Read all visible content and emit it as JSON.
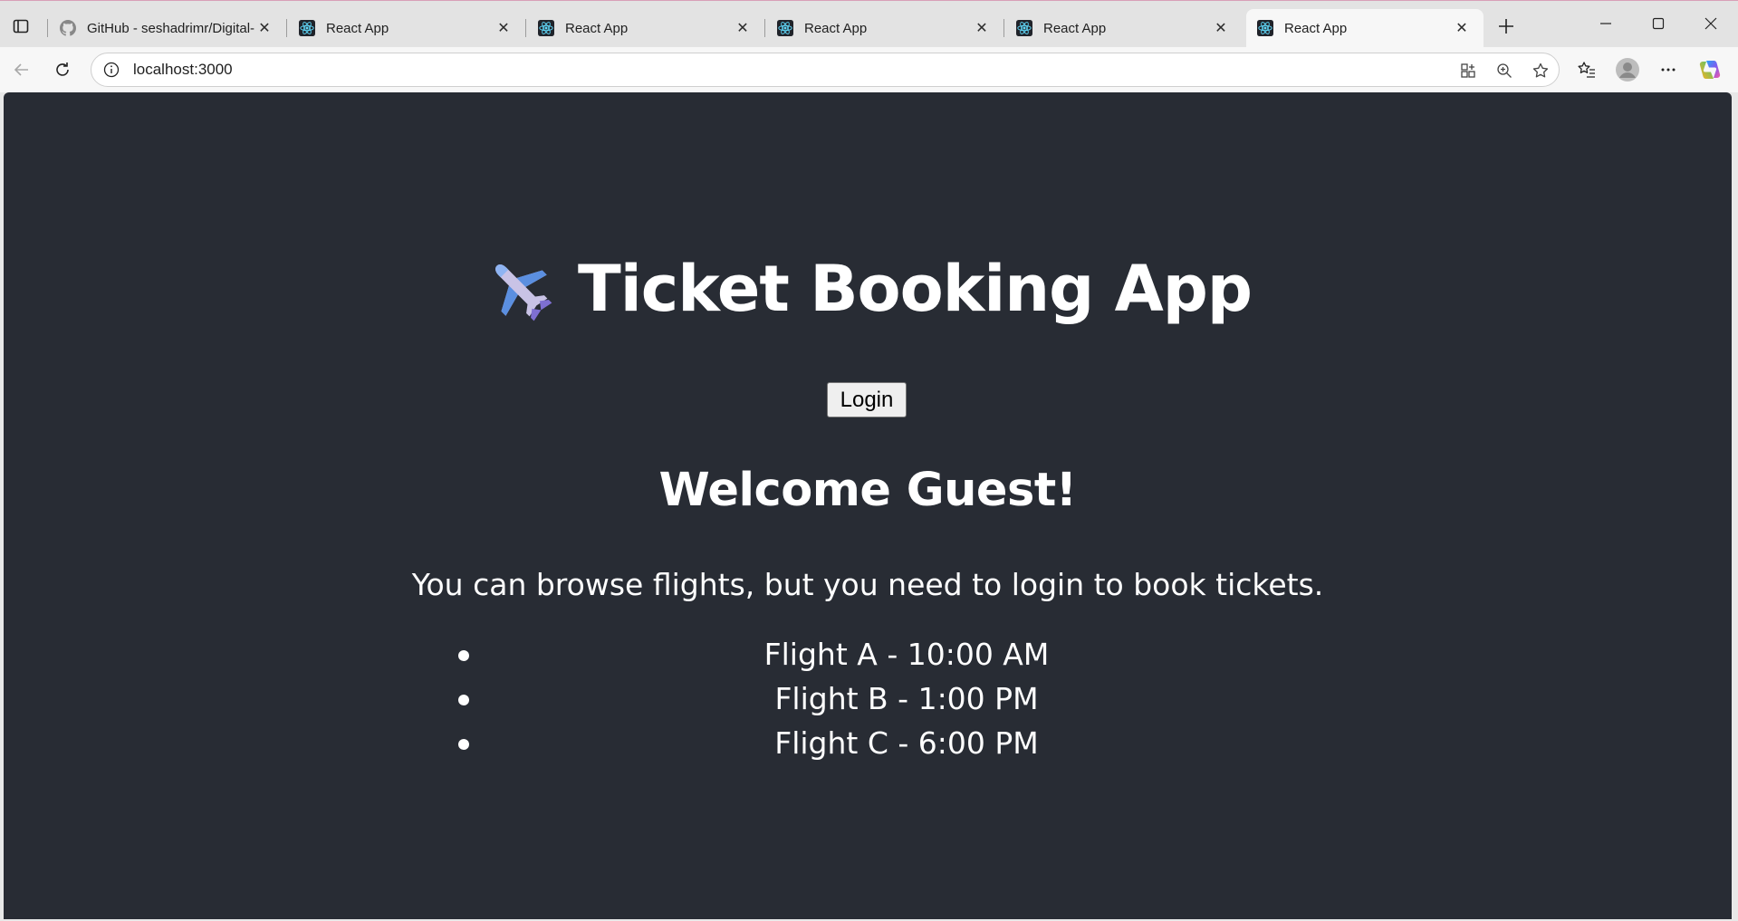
{
  "browser": {
    "tabs": [
      {
        "title": "GitHub - seshadrimr/Digital-",
        "favicon": "github-icon",
        "active": false
      },
      {
        "title": "React App",
        "favicon": "react-icon",
        "active": false
      },
      {
        "title": "React App",
        "favicon": "react-icon",
        "active": false
      },
      {
        "title": "React App",
        "favicon": "react-icon",
        "active": false
      },
      {
        "title": "React App",
        "favicon": "react-icon",
        "active": false
      },
      {
        "title": "React App",
        "favicon": "react-icon",
        "active": true
      }
    ],
    "address_bar": {
      "url": "localhost:3000"
    },
    "close_glyph": "✕"
  },
  "app": {
    "title": "Ticket Booking App",
    "title_icon": "airplane-icon",
    "login_label": "Login",
    "welcome": "Welcome Guest!",
    "message": "You can browse flights, but you need to login to book tickets.",
    "flights": [
      "Flight A - 10:00 AM",
      "Flight B - 1:00 PM",
      "Flight C - 6:00 PM"
    ]
  },
  "colors": {
    "page_background": "#282c34",
    "text": "#ffffff",
    "react_accent": "#61dafb"
  }
}
